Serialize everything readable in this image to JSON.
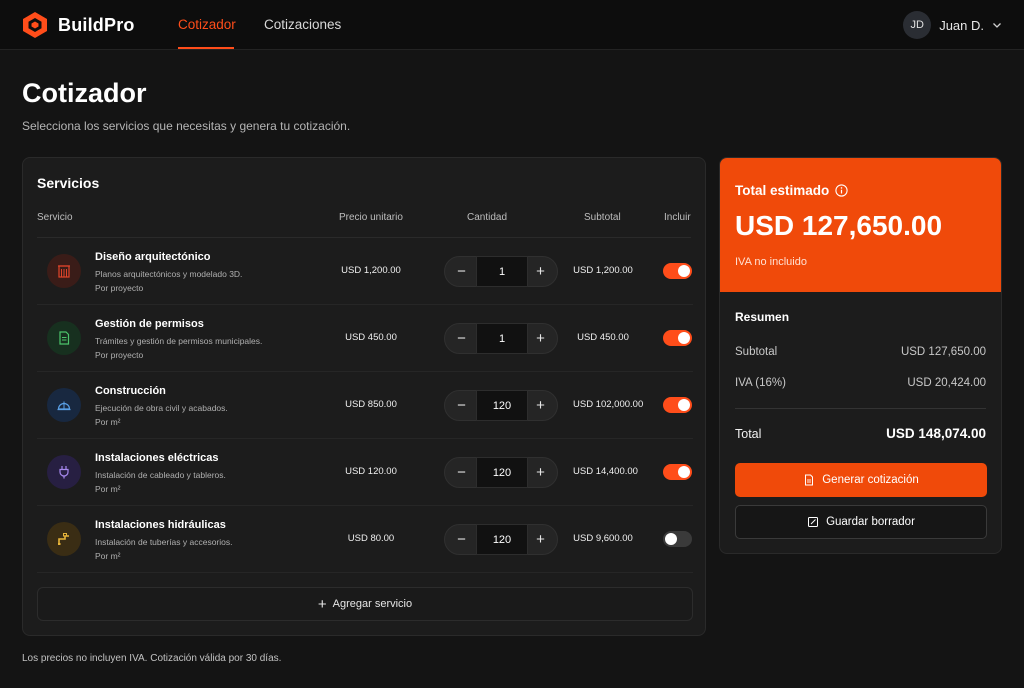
{
  "app": {
    "brand": "BuildPro",
    "brand_color": "#ff4d1a"
  },
  "nav": {
    "tabs": [
      {
        "label": "Cotizador",
        "active": true
      },
      {
        "label": "Cotizaciones",
        "active": false
      }
    ],
    "user": {
      "initials": "JD",
      "name": "Juan D."
    }
  },
  "page": {
    "title": "Cotizador",
    "subtitle": "Selecciona los servicios que necesitas y genera tu cotización."
  },
  "services": {
    "title": "Servicios",
    "columns": {
      "service": "Servicio",
      "unit_price": "Precio unitario",
      "quantity": "Cantidad",
      "subtotal": "Subtotal",
      "include": "Incluir"
    },
    "rows": [
      {
        "icon": "building-icon",
        "icon_color": "#e0442a",
        "icon_bg": "#3a1c18",
        "name": "Diseño arquitectónico",
        "desc": "Planos arquitectónicos y modelado 3D.",
        "unit": "Por proyecto",
        "price": "USD 1,200.00",
        "qty": "1",
        "subtotal": "USD 1,200.00",
        "included": true
      },
      {
        "icon": "document-icon",
        "icon_color": "#4cc46a",
        "icon_bg": "#17301f",
        "name": "Gestión de permisos",
        "desc": "Trámites y gestión de permisos municipales.",
        "unit": "Por proyecto",
        "price": "USD 450.00",
        "qty": "1",
        "subtotal": "USD 450.00",
        "included": true
      },
      {
        "icon": "helmet-icon",
        "icon_color": "#5aa0e6",
        "icon_bg": "#182840",
        "name": "Construcción",
        "desc": "Ejecución de obra civil y acabados.",
        "unit": "Por m²",
        "price": "USD 850.00",
        "qty": "120",
        "subtotal": "USD 102,000.00",
        "included": true
      },
      {
        "icon": "plug-icon",
        "icon_color": "#a88af0",
        "icon_bg": "#271f42",
        "name": "Instalaciones eléctricas",
        "desc": "Instalación de cableado y tableros.",
        "unit": "Por m²",
        "price": "USD 120.00",
        "qty": "120",
        "subtotal": "USD 14,400.00",
        "included": true
      },
      {
        "icon": "pipe-icon",
        "icon_color": "#e8b53a",
        "icon_bg": "#3a2d14",
        "name": "Instalaciones hidráulicas",
        "desc": "Instalación de tuberías y accesorios.",
        "unit": "Por m²",
        "price": "USD 80.00",
        "qty": "120",
        "subtotal": "USD 9,600.00",
        "included": false
      }
    ],
    "add_label": "Agregar servicio"
  },
  "footnote": "Los precios no incluyen IVA. Cotización válida por 30 días.",
  "summary": {
    "total_label": "Total estimado",
    "total_amount": "USD 127,650.00",
    "total_note": "IVA no incluido",
    "title": "Resumen",
    "lines": [
      {
        "label": "Subtotal",
        "value": "USD 127,650.00"
      },
      {
        "label": "IVA (16%)",
        "value": "USD 20,424.00"
      }
    ],
    "grand_label": "Total",
    "grand_value": "USD 148,074.00",
    "primary_button": "Generar cotización",
    "secondary_button": "Guardar borrador",
    "accent": "#f04a0a"
  }
}
